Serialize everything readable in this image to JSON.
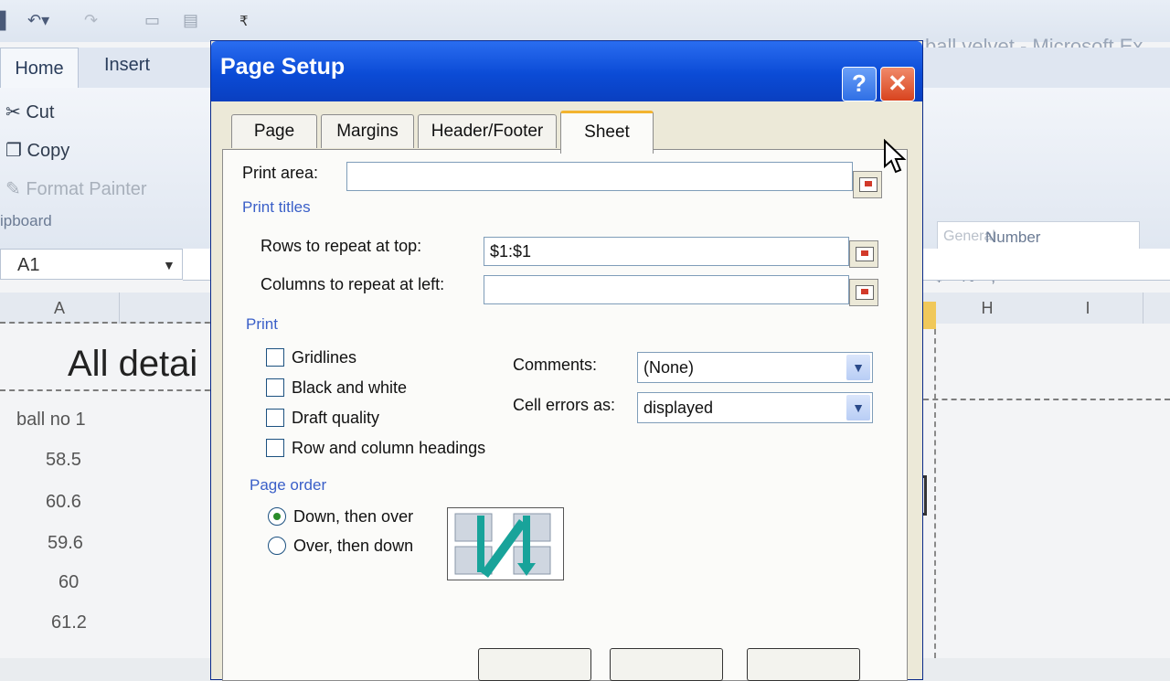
{
  "excel": {
    "window_title": "ball velvet - Microsoft Ex",
    "ribbon_tabs": [
      "Home",
      "Insert"
    ],
    "clipboard": {
      "cut": "Cut",
      "copy": "Copy",
      "format_painter": "Format Painter",
      "group_label": "ipboard"
    },
    "number": {
      "format": "General",
      "group_label": "Number",
      "buttons": "$  %  ,"
    },
    "name_box": "A1",
    "columns": {
      "a": "A",
      "h": "H",
      "i": "I"
    },
    "title_cell": "All detai",
    "column_a_values": [
      "ball no 1",
      "58.5",
      "60.6",
      "59.6",
      "60",
      "61.2"
    ]
  },
  "dialog": {
    "title": "Page Setup",
    "tabs": [
      "Page",
      "Margins",
      "Header/Footer",
      "Sheet"
    ],
    "active_tab": "Sheet",
    "print_area_label": "Print area:",
    "print_area_value": "",
    "print_titles_label": "Print titles",
    "rows_repeat_label": "Rows to repeat at top:",
    "rows_repeat_value": "$1:$1",
    "cols_repeat_label": "Columns to repeat at left:",
    "cols_repeat_value": "",
    "print_group_label": "Print",
    "checkboxes": [
      "Gridlines",
      "Black and white",
      "Draft quality",
      "Row and column headings"
    ],
    "comments_label": "Comments:",
    "comments_value": "(None)",
    "cell_errors_label": "Cell errors as:",
    "cell_errors_value": "displayed",
    "page_order_label": "Page order",
    "page_order_options": [
      "Down, then over",
      "Over, then down"
    ],
    "page_order_selected": "Down, then over",
    "accent_color": "#0b4bd6"
  }
}
